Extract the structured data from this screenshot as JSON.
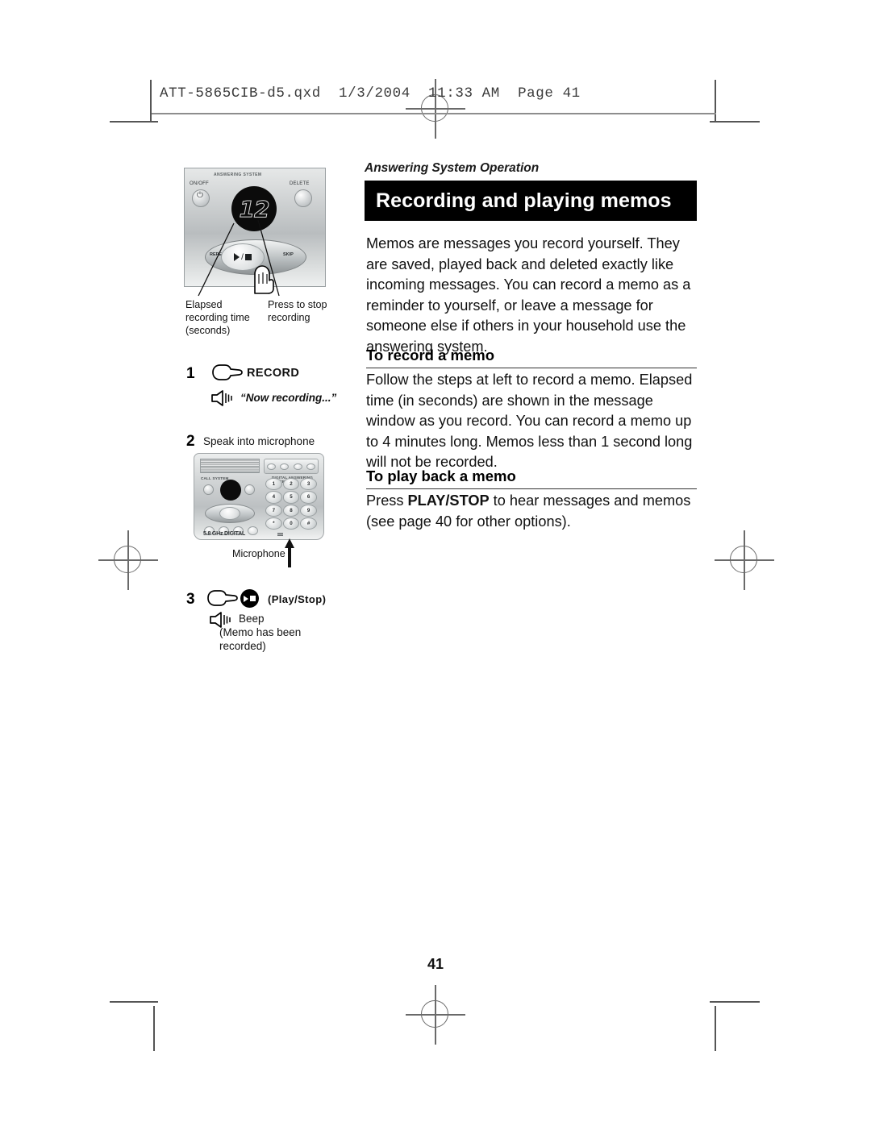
{
  "file_header": "ATT-5865CIB-d5.qxd  1/3/2004  11:33 AM  Page 41",
  "page_number": "41",
  "content": {
    "kicker": "Answering System Operation",
    "title": "Recording and playing memos",
    "intro": "Memos are messages you record yourself. They are saved, played back and deleted exactly like incoming messages. You can record a memo as a reminder to yourself, or leave a message for someone else if others in your household use the answering system.",
    "sections": [
      {
        "heading": "To record a memo",
        "body": "Follow the steps at left to record a memo. Elapsed time (in seconds) are shown in the message window as you record. You can record a memo up to 4 minutes long. Memos less than 1 second long will not be recorded."
      },
      {
        "heading": "To play back a memo",
        "body_before": "Press ",
        "body_bold": "PLAY/STOP",
        "body_after": " to hear messages and memos (see page 40 for other options)."
      }
    ]
  },
  "illustration": {
    "control_panel": {
      "brand": "ANSWERING SYSTEM",
      "on_off_label": "ON/OFF",
      "delete_label": "DELETE",
      "display_value": "12",
      "repeat_label": "REPEAT",
      "skip_label": "SKIP"
    },
    "callouts": {
      "elapsed": "Elapsed recording time (seconds)",
      "stop": "Press to stop recording"
    },
    "base_unit": {
      "brand_left": "CALL SYSTEM",
      "brand_right": "DIGITAL ANSWERING SYSTEM",
      "frequency": "5.8 GHz DIGITAL",
      "keys": [
        "1",
        "2",
        "3",
        "4",
        "5",
        "6",
        "7",
        "8",
        "9",
        "*",
        "0",
        "#"
      ]
    },
    "microphone_label": "Microphone"
  },
  "steps": [
    {
      "number": "1",
      "action": "RECORD",
      "voice_prompt": "“Now recording...”"
    },
    {
      "number": "2",
      "action": "Speak into microphone"
    },
    {
      "number": "3",
      "action": "(Play/Stop)",
      "beep_line1": "Beep",
      "beep_line2": "(Memo has been",
      "beep_line3": "recorded)"
    }
  ]
}
